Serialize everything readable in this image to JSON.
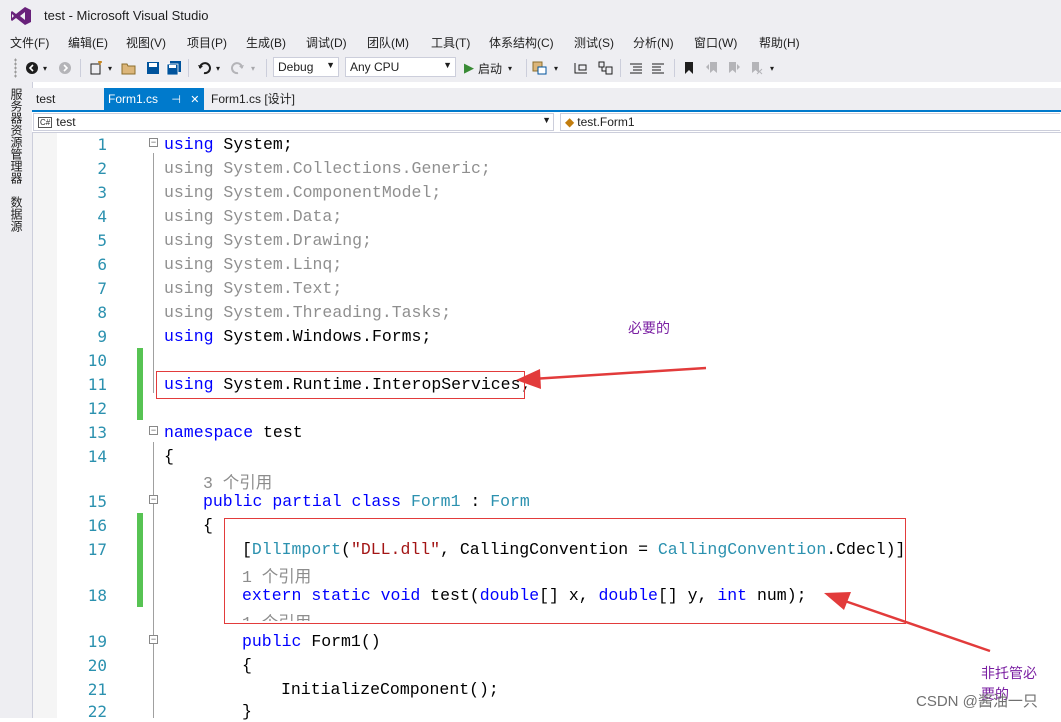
{
  "window": {
    "title": "test - Microsoft Visual Studio"
  },
  "menu": [
    "文件(F)",
    "编辑(E)",
    "视图(V)",
    "项目(P)",
    "生成(B)",
    "调试(D)",
    "团队(M)",
    "工具(T)",
    "体系结构(C)",
    "测试(S)",
    "分析(N)",
    "窗口(W)",
    "帮助(H)"
  ],
  "toolbar": {
    "configuration": "Debug",
    "platform": "Any CPU",
    "start_label": "启动"
  },
  "sidebar": {
    "tabs": [
      "服务器资源管理器",
      "数据源"
    ]
  },
  "tabs": {
    "project": "test",
    "active": "Form1.cs",
    "designer": "Form1.cs [设计]"
  },
  "navbar": {
    "project_scope": "test",
    "type_scope": "test.Form1"
  },
  "editor": {
    "l1": {
      "kw": "using",
      "rest": " System;"
    },
    "l2": "using System.Collections.Generic;",
    "l3": "using System.ComponentModel;",
    "l4": "using System.Data;",
    "l5": "using System.Drawing;",
    "l6": "using System.Linq;",
    "l7": "using System.Text;",
    "l8": "using System.Threading.Tasks;",
    "l9": {
      "kw": "using",
      "rest": " System.Windows.Forms;"
    },
    "l11": {
      "kw": "using",
      "rest": " System.Runtime.InteropServices;"
    },
    "l13": {
      "kw": "namespace",
      "rest": " test"
    },
    "l14": "{",
    "lens1": "3 个引用",
    "l15": {
      "kw1": "public",
      "kw2": "partial",
      "kw3": "class",
      "ty1": "Form1",
      "sep": " : ",
      "ty2": "Form"
    },
    "l16": "{",
    "l17": {
      "open": "[",
      "ty1": "DllImport",
      "p1": "(",
      "str": "\"DLL.dll\"",
      "p2": ", CallingConvention = ",
      "ty2": "CallingConvention",
      "p3": ".Cdecl)]"
    },
    "lens2": "1 个引用",
    "l18": {
      "kw1": "extern",
      "kw2": "static",
      "kw3": "void",
      "name": " test(",
      "kw4": "double",
      "a": "[] x, ",
      "kw5": "double",
      "b": "[] y, ",
      "kw6": "int",
      "c": " num);"
    },
    "lens3": "1 个引用",
    "l19": {
      "kw": "public",
      "rest": " Form1()"
    },
    "l20": "{",
    "l21": "InitializeComponent();",
    "l22": "}"
  },
  "line_numbers": [
    "1",
    "2",
    "3",
    "4",
    "5",
    "6",
    "7",
    "8",
    "9",
    "10",
    "11",
    "12",
    "13",
    "14",
    "15",
    "16",
    "17",
    "18",
    "19",
    "20",
    "21",
    "22"
  ],
  "annotations": {
    "required": "必要的",
    "unmanaged_line1": "非托管必",
    "unmanaged_line2": "要的"
  },
  "watermark": "CSDN @酱油一只",
  "colors": {
    "accent": "#007acc",
    "keyword": "#0000ff",
    "type": "#2b91af",
    "string": "#a31515",
    "annotation_red": "#e23b3b",
    "annotation_text": "#7a1fa2",
    "change_bar": "#57c353"
  }
}
